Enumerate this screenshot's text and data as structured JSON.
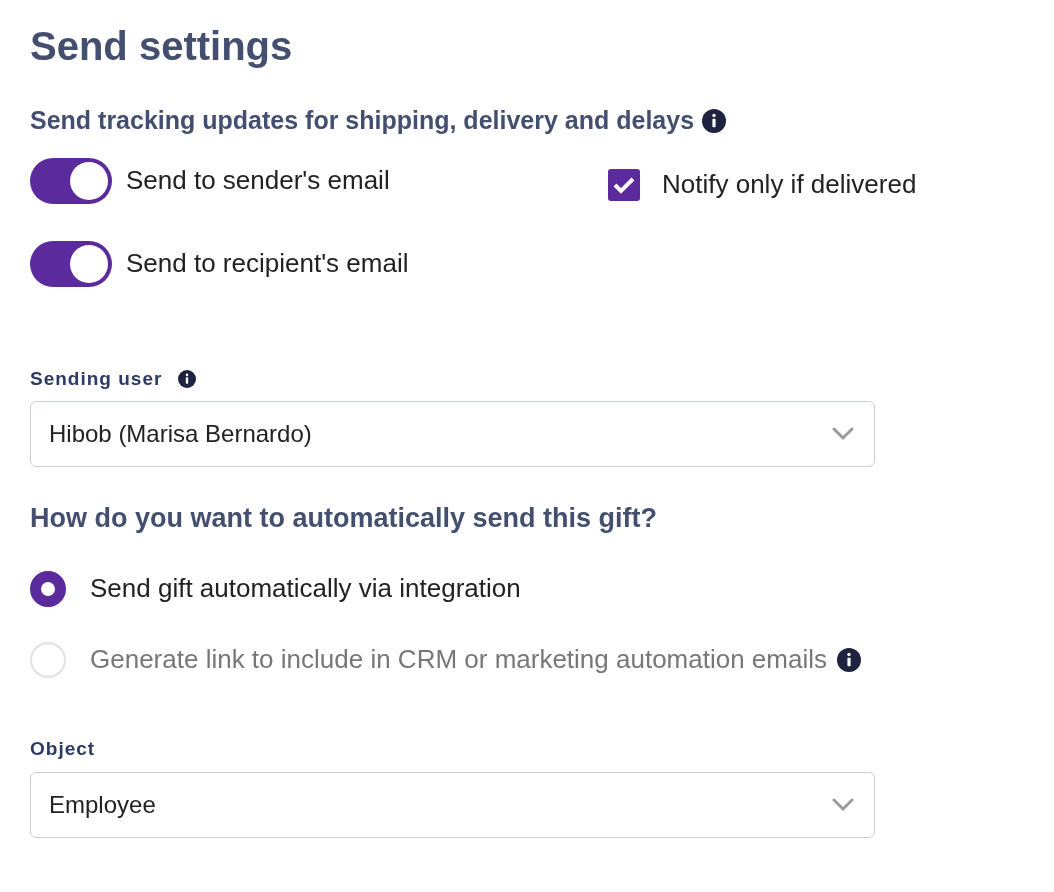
{
  "title": "Send settings",
  "tracking": {
    "heading": "Send tracking updates for shipping, delivery and delays",
    "toggles": [
      {
        "label": "Send to sender's email",
        "on": true
      },
      {
        "label": "Send to recipient's email",
        "on": true
      }
    ],
    "checkbox": {
      "label": "Notify only if delivered",
      "checked": true
    }
  },
  "sending_user": {
    "label": "Sending user",
    "value": "Hibob (Marisa Bernardo)"
  },
  "method": {
    "heading": "How do you want to automatically send this gift?",
    "options": [
      {
        "label": "Send gift automatically via integration",
        "selected": true,
        "disabled": false,
        "info": false
      },
      {
        "label": "Generate link to include in CRM or marketing automation emails",
        "selected": false,
        "disabled": true,
        "info": true
      }
    ]
  },
  "object": {
    "label": "Object",
    "value": "Employee"
  }
}
